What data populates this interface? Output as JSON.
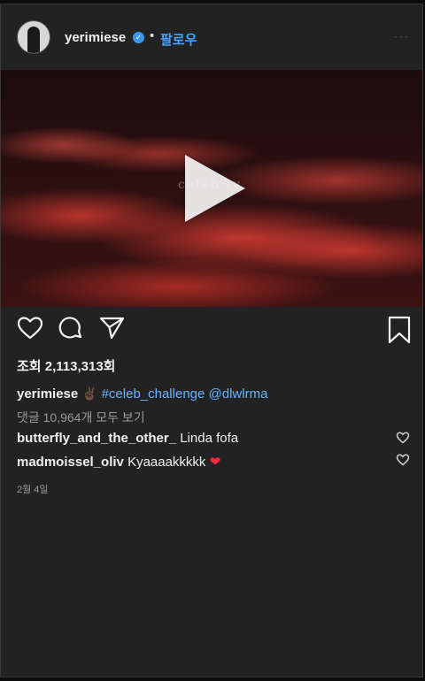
{
  "post": {
    "username": "yerimiese",
    "verified": true,
    "dot": "•",
    "follow_label": "팔로우",
    "more_label": "···",
    "media": {
      "type": "video",
      "watermark": "celeb·ty"
    },
    "views": "조회 2,113,313회",
    "caption": {
      "username": "yerimiese",
      "emoji": "✌🏿",
      "hashtag": "#celeb_challenge",
      "mention": "@dlwlrma"
    },
    "view_all_comments": "댓글 10,964개 모두 보기",
    "comments": [
      {
        "username": "butterfly_and_the_other_",
        "text": "Linda fofa",
        "emoji": ""
      },
      {
        "username": "madmoissel_oliv",
        "text": "Kyaaaakkkkk",
        "emoji": "❤"
      }
    ],
    "date": "2월 4일"
  },
  "icons": [
    "heart-icon",
    "comment-icon",
    "share-icon",
    "bookmark-icon",
    "play-icon",
    "verified-badge-icon",
    "more-options-icon"
  ],
  "colors": {
    "background": "#222222",
    "link": "#4aa3ff",
    "hashtag": "#6ab4ff",
    "verified": "#3897f0",
    "muted": "#9a9a9a"
  }
}
